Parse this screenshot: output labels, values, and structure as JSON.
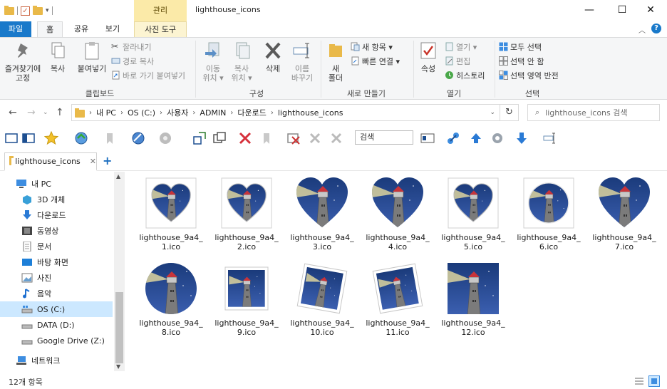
{
  "titlebar": {
    "context_tab": "관리",
    "title": "lighthouse_icons",
    "minimize": "—",
    "maximize": "☐",
    "close": "✕"
  },
  "tabs": {
    "file": "파일",
    "home": "홈",
    "share": "공유",
    "view": "보기",
    "photo_tools": "사진 도구",
    "help": "?"
  },
  "ribbon": {
    "pin_quick_access": "즐겨찾기에\n고정",
    "copy": "복사",
    "paste": "붙여넣기",
    "cut": "잘라내기",
    "copy_path": "경로 복사",
    "paste_shortcut": "바로 가기 붙여넣기",
    "group_clipboard": "클립보드",
    "move_to": "이동\n위치 ▾",
    "copy_to": "복사\n위치 ▾",
    "delete": "삭제",
    "rename": "이름\n바꾸기",
    "group_organize": "구성",
    "new_folder": "새\n폴더",
    "new_item": "새 항목 ▾",
    "easy_access": "빠른 연결 ▾",
    "group_new": "새로 만들기",
    "properties": "속성",
    "open": "열기 ▾",
    "edit": "편집",
    "history": "히스토리",
    "group_open": "열기",
    "select_all": "모두 선택",
    "select_none": "선택 안 함",
    "invert_selection": "선택 영역 반전",
    "group_select": "선택"
  },
  "address": {
    "crumbs": [
      "내 PC",
      "OS (C:)",
      "사용자",
      "ADMIN",
      "다운로드",
      "lighthouse_icons"
    ],
    "search_placeholder": "lighthouse_icons 검색"
  },
  "toolbar": {
    "search_label": "검색"
  },
  "folder_tab": {
    "label": "lighthouse_icons",
    "close": "✕",
    "add": "+"
  },
  "nav": {
    "items": [
      {
        "label": "내 PC",
        "icon": "pc-icon"
      },
      {
        "label": "3D 개체",
        "icon": "cube-icon"
      },
      {
        "label": "다운로드",
        "icon": "download-icon"
      },
      {
        "label": "동영상",
        "icon": "video-icon"
      },
      {
        "label": "문서",
        "icon": "document-icon"
      },
      {
        "label": "바탕 화면",
        "icon": "desktop-icon"
      },
      {
        "label": "사진",
        "icon": "pictures-icon"
      },
      {
        "label": "음악",
        "icon": "music-icon"
      },
      {
        "label": "OS (C:)",
        "icon": "drive-icon"
      },
      {
        "label": "DATA (D:)",
        "icon": "drive-icon"
      },
      {
        "label": "Google Drive (Z:)",
        "icon": "drive-icon"
      },
      {
        "label": "네트워크",
        "icon": "network-icon"
      }
    ]
  },
  "files": [
    {
      "line1": "lighthouse_9a4_",
      "line2": "1.ico",
      "shape": "heart-frame"
    },
    {
      "line1": "lighthouse_9a4_",
      "line2": "2.ico",
      "shape": "heart-frame"
    },
    {
      "line1": "lighthouse_9a4_",
      "line2": "3.ico",
      "shape": "heart"
    },
    {
      "line1": "lighthouse_9a4_",
      "line2": "4.ico",
      "shape": "heart"
    },
    {
      "line1": "lighthouse_9a4_",
      "line2": "5.ico",
      "shape": "heart-frame"
    },
    {
      "line1": "lighthouse_9a4_",
      "line2": "6.ico",
      "shape": "circle-frame"
    },
    {
      "line1": "lighthouse_9a4_",
      "line2": "7.ico",
      "shape": "heart"
    },
    {
      "line1": "lighthouse_9a4_",
      "line2": "8.ico",
      "shape": "circle"
    },
    {
      "line1": "lighthouse_9a4_",
      "line2": "9.ico",
      "shape": "photo"
    },
    {
      "line1": "lighthouse_9a4_",
      "line2": "10.ico",
      "shape": "photo-tilt"
    },
    {
      "line1": "lighthouse_9a4_",
      "line2": "11.ico",
      "shape": "photo-tilt2"
    },
    {
      "line1": "lighthouse_9a4_",
      "line2": "12.ico",
      "shape": "square"
    }
  ],
  "status": {
    "count": "12개 항목"
  }
}
